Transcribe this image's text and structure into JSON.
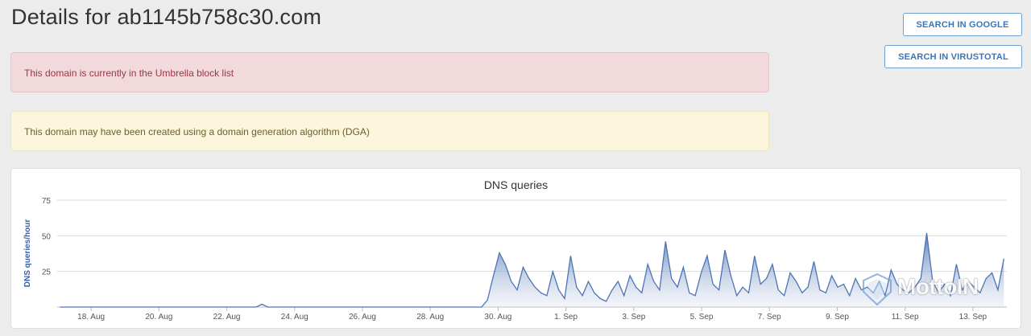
{
  "header": {
    "title": "Details for ab1145b758c30.com"
  },
  "actions": {
    "google_label": "SEARCH IN GOOGLE",
    "virustotal_label": "SEARCH IN VIRUSTOTAL"
  },
  "alerts": {
    "blocklist": "This domain is currently in the Umbrella block list",
    "dga": "This domain may have been created using a domain generation algorithm (DGA)"
  },
  "colors": {
    "danger_bg": "#f1d9dc",
    "warning_bg": "#fbf6dc",
    "accent": "#3a75b8",
    "series": "#4d74b6"
  },
  "watermark": {
    "text": "MottoIN"
  },
  "chart_data": {
    "type": "area",
    "title": "DNS queries",
    "ylabel": "DNS queries/hour",
    "xlabel": "",
    "ylim": [
      0,
      75
    ],
    "yticks": [
      25,
      50,
      75
    ],
    "grid": true,
    "x_start_day": "17 Aug",
    "x_end_day": "14 Sep",
    "xticks": [
      {
        "label": "18. Aug",
        "day": 1
      },
      {
        "label": "20. Aug",
        "day": 3
      },
      {
        "label": "22. Aug",
        "day": 5
      },
      {
        "label": "24. Aug",
        "day": 7
      },
      {
        "label": "26. Aug",
        "day": 9
      },
      {
        "label": "28. Aug",
        "day": 11
      },
      {
        "label": "30. Aug",
        "day": 13
      },
      {
        "label": "1. Sep",
        "day": 15
      },
      {
        "label": "3. Sep",
        "day": 17
      },
      {
        "label": "5. Sep",
        "day": 19
      },
      {
        "label": "7. Sep",
        "day": 21
      },
      {
        "label": "9. Sep",
        "day": 23
      },
      {
        "label": "11. Sep",
        "day": 25
      },
      {
        "label": "13. Sep",
        "day": 27
      }
    ],
    "series": [
      {
        "values_per_6h": [
          0,
          0,
          0,
          0,
          0,
          0,
          0,
          0,
          0,
          0,
          0,
          0,
          0,
          0,
          0,
          0,
          0,
          0,
          0,
          0,
          0,
          0,
          0,
          0,
          0,
          0,
          0,
          0,
          0,
          0,
          0,
          0,
          0,
          0,
          2,
          0,
          0,
          0,
          0,
          0,
          0,
          0,
          0,
          0,
          0,
          0,
          0,
          0,
          0,
          0,
          0,
          0,
          0,
          0,
          0,
          0,
          0,
          0,
          0,
          0,
          0,
          0,
          0,
          0,
          0,
          0,
          0,
          0,
          0,
          0,
          0,
          0,
          5,
          22,
          38,
          30,
          18,
          12,
          28,
          20,
          14,
          10,
          8,
          25,
          12,
          6,
          36,
          14,
          8,
          18,
          10,
          6,
          4,
          12,
          18,
          8,
          22,
          14,
          10,
          30,
          18,
          12,
          46,
          20,
          14,
          28,
          10,
          8,
          24,
          36,
          16,
          12,
          40,
          22,
          8,
          14,
          10,
          36,
          16,
          20,
          30,
          12,
          8,
          24,
          18,
          10,
          14,
          32,
          12,
          10,
          22,
          14,
          16,
          8,
          20,
          12,
          14,
          10,
          18,
          8,
          26,
          16,
          12,
          10,
          14,
          20,
          52,
          18,
          10,
          16,
          8,
          30,
          12,
          18,
          14,
          10,
          20,
          24,
          12,
          34
        ]
      }
    ]
  }
}
